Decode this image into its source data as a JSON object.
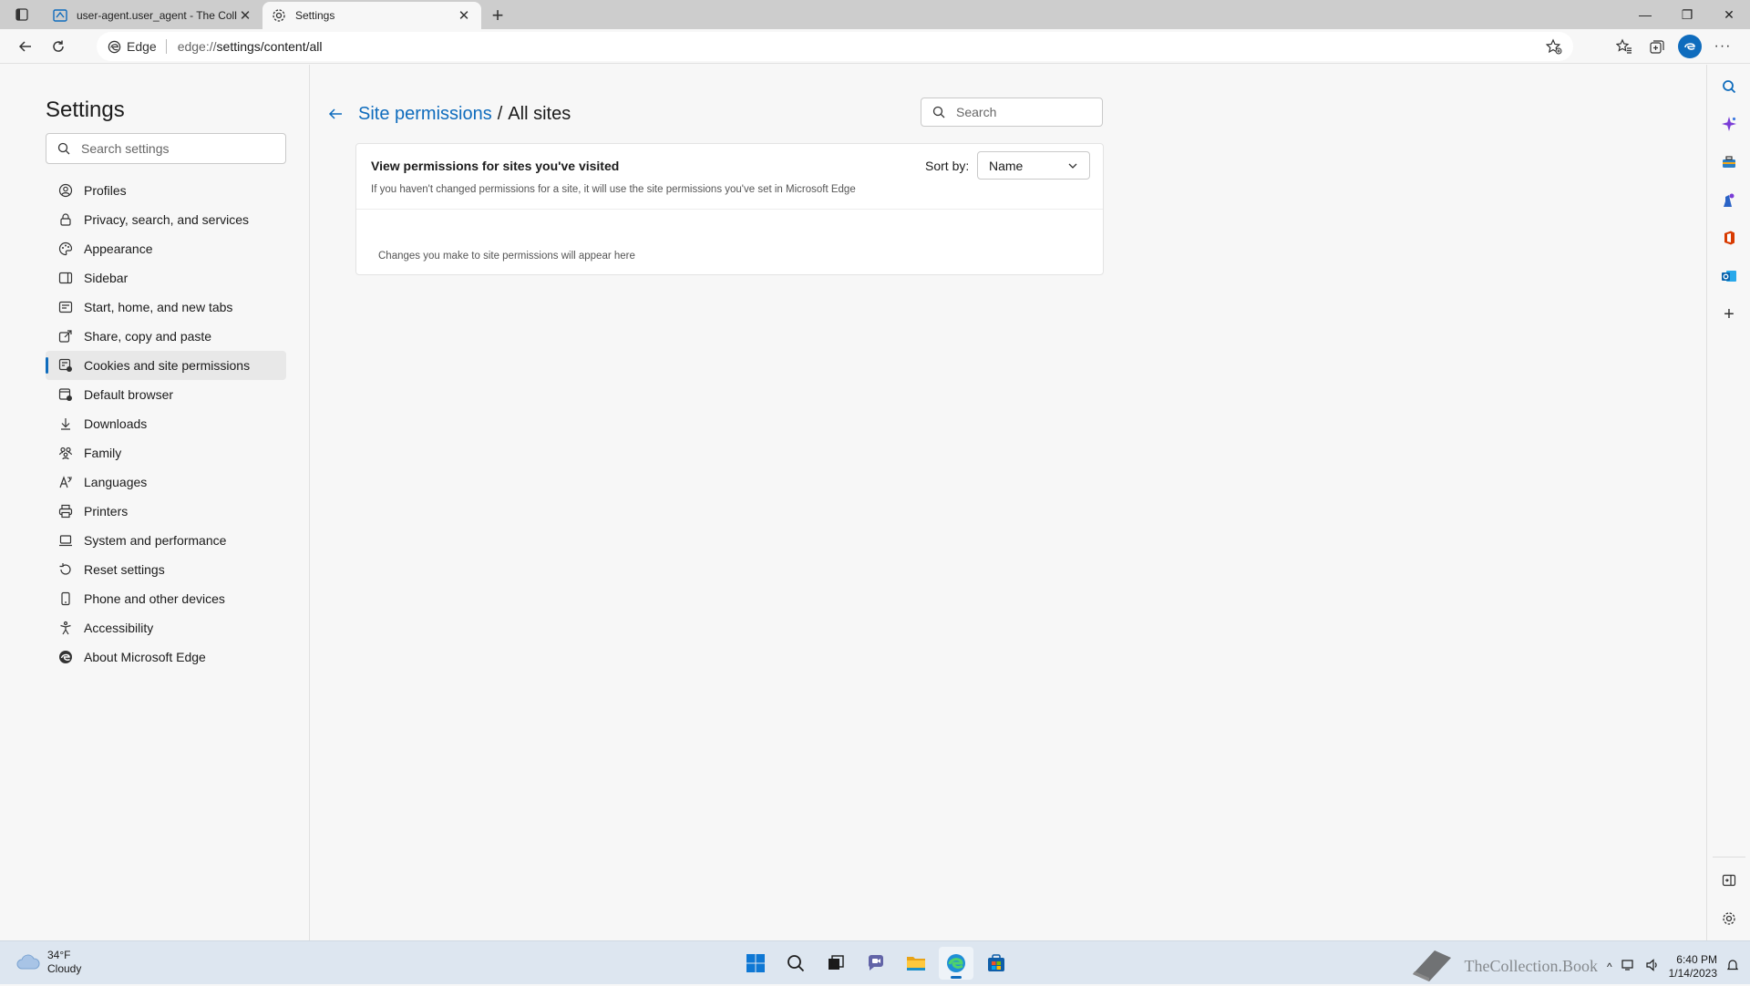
{
  "tabs": [
    {
      "title": "user-agent.user_agent - The Coll",
      "active": false
    },
    {
      "title": "Settings",
      "active": true
    }
  ],
  "toolbar": {
    "omnibox_label": "Edge",
    "url_scheme": "edge://",
    "url_path": "settings/content/all"
  },
  "nav": {
    "title": "Settings",
    "search_placeholder": "Search settings",
    "items": [
      {
        "label": "Profiles",
        "icon": "profile-icon"
      },
      {
        "label": "Privacy, search, and services",
        "icon": "lock-icon"
      },
      {
        "label": "Appearance",
        "icon": "appearance-icon"
      },
      {
        "label": "Sidebar",
        "icon": "sidebar-icon"
      },
      {
        "label": "Start, home, and new tabs",
        "icon": "home-icon"
      },
      {
        "label": "Share, copy and paste",
        "icon": "share-icon"
      },
      {
        "label": "Cookies and site permissions",
        "icon": "cookie-icon",
        "selected": true
      },
      {
        "label": "Default browser",
        "icon": "browser-icon"
      },
      {
        "label": "Downloads",
        "icon": "download-icon"
      },
      {
        "label": "Family",
        "icon": "family-icon"
      },
      {
        "label": "Languages",
        "icon": "language-icon"
      },
      {
        "label": "Printers",
        "icon": "printer-icon"
      },
      {
        "label": "System and performance",
        "icon": "laptop-icon"
      },
      {
        "label": "Reset settings",
        "icon": "reset-icon"
      },
      {
        "label": "Phone and other devices",
        "icon": "phone-icon"
      },
      {
        "label": "Accessibility",
        "icon": "accessibility-icon"
      },
      {
        "label": "About Microsoft Edge",
        "icon": "edge-icon"
      }
    ]
  },
  "content": {
    "breadcrumb_link": "Site permissions",
    "breadcrumb_sep": "/",
    "breadcrumb_current": "All sites",
    "search_placeholder": "Search",
    "card": {
      "heading": "View permissions for sites you've visited",
      "subtext": "If you haven't changed permissions for a site, it will use the site permissions you've set in Microsoft Edge",
      "sort_label": "Sort by:",
      "sort_value": "Name",
      "empty_text": "Changes you make to site permissions will appear here"
    }
  },
  "taskbar": {
    "weather_temp": "34°F",
    "weather_cond": "Cloudy",
    "time": "6:40 PM",
    "date": "1/14/2023",
    "watermark": "TheCollection.Book"
  },
  "colors": {
    "accent": "#0f6cbd",
    "page_bg": "#f7f7f7",
    "taskbar_bg": "#dde6f0"
  }
}
